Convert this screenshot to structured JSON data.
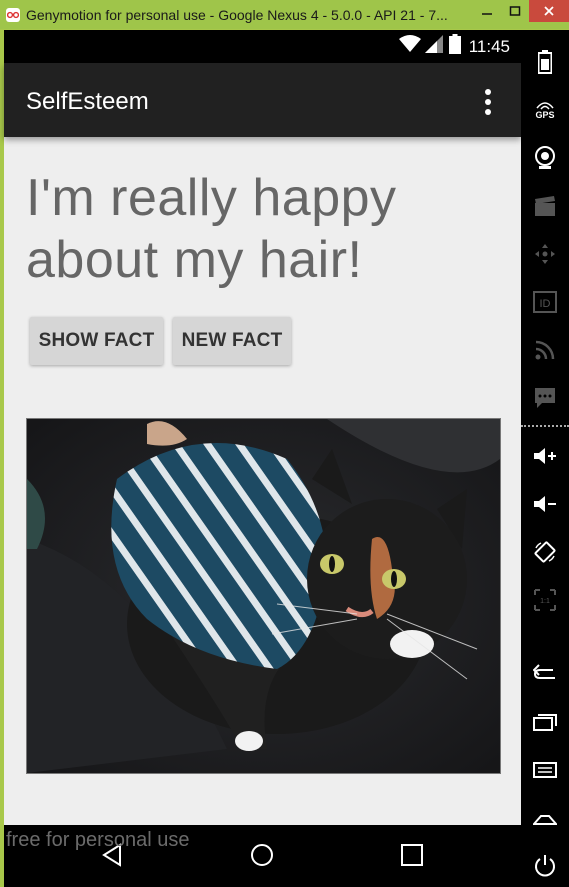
{
  "window": {
    "title": "Genymotion for personal use - Google Nexus 4 - 5.0.0 - API 21 - 7..."
  },
  "status_bar": {
    "time": "11:45"
  },
  "app_bar": {
    "title": "SelfEsteem"
  },
  "content": {
    "fact_text": "I'm really happy about my hair!",
    "show_fact_label": "SHOW FACT",
    "new_fact_label": "NEW FACT"
  },
  "watermark": "free for personal use",
  "toolbar": {
    "gps_label": "GPS",
    "id_label": "ID",
    "ratio_label": "1:1"
  },
  "icons": {
    "wifi": "wifi-icon",
    "signal": "cell-signal-icon",
    "battery": "battery-icon",
    "overflow": "more-vert-icon",
    "back": "back-icon",
    "home": "home-icon",
    "recents": "recents-icon"
  },
  "colors": {
    "title_bar": "#9fc54a",
    "app_bar": "#212121",
    "content_bg": "#eeeeee",
    "button_bg": "#d6d6d6",
    "close_button": "#c94a3d"
  }
}
